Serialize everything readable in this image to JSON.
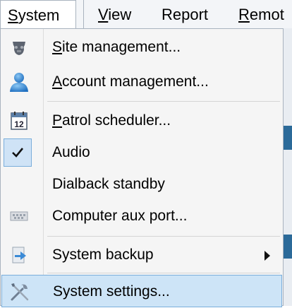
{
  "menubar": {
    "items": [
      {
        "mnemonic": "S",
        "rest": "ystem"
      },
      {
        "mnemonic": "V",
        "rest": "iew"
      },
      {
        "label": "Report"
      },
      {
        "mnemonic": "R",
        "rest": "emot"
      }
    ]
  },
  "menu": {
    "items": [
      {
        "mnemonic": "S",
        "rest": "ite management..."
      },
      {
        "mnemonic": "A",
        "rest": "ccount management..."
      },
      {
        "mnemonic": "P",
        "rest": "atrol scheduler..."
      },
      {
        "label": "Audio"
      },
      {
        "label": "Dialback standby"
      },
      {
        "label": "Computer aux port..."
      },
      {
        "label": "System backup"
      },
      {
        "label": "System settings..."
      }
    ],
    "calendar_icon_text": "12"
  },
  "icons": {
    "site": "site-management-icon",
    "account": "user-icon",
    "calendar": "calendar-icon",
    "check": "checkmark-icon",
    "aux": "aux-port-icon",
    "backup": "backup-icon",
    "settings": "tools-icon",
    "submenu": "submenu-arrow-icon"
  },
  "colors": {
    "menubar_bg": "#f3f5f8",
    "menu_bg": "#f5f5f5",
    "highlight_bg": "#cde4f7",
    "highlight_border": "#7aaedb",
    "accent": "#2b6a99"
  }
}
